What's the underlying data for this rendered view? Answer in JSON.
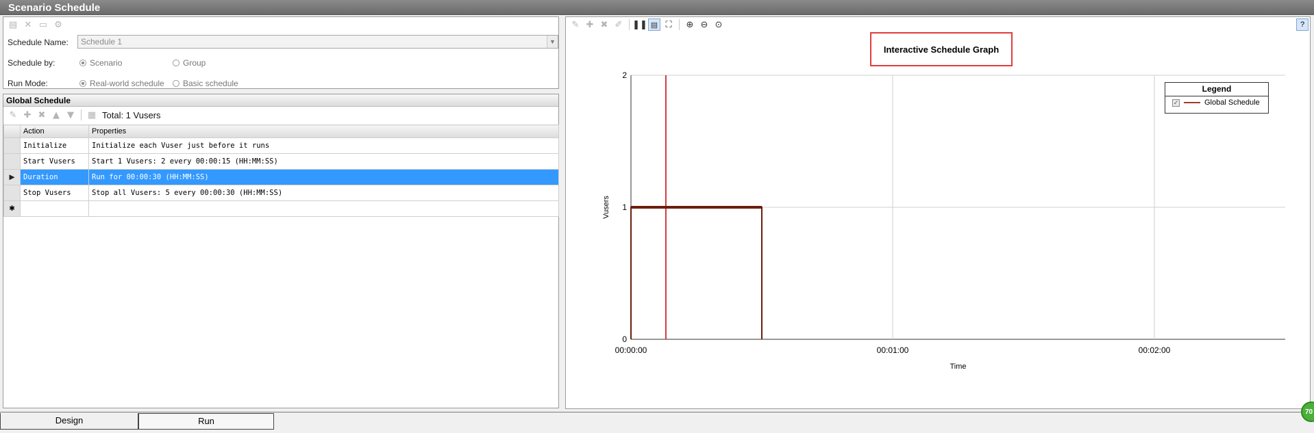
{
  "window": {
    "title": "Scenario Schedule"
  },
  "settings": {
    "schedule_name_label": "Schedule Name:",
    "schedule_name_value": "Schedule 1",
    "schedule_by_label": "Schedule by:",
    "schedule_by_options": [
      "Scenario",
      "Group"
    ],
    "schedule_by_selected": "Scenario",
    "run_mode_label": "Run Mode:",
    "run_mode_options": [
      "Real-world schedule",
      "Basic schedule"
    ],
    "run_mode_selected": "Real-world schedule"
  },
  "global_schedule": {
    "title": "Global Schedule",
    "total_label": "Total: 1 Vusers",
    "columns": [
      "Action",
      "Properties"
    ],
    "rows": [
      {
        "action": "Initialize",
        "properties": "Initialize each Vuser just before it runs"
      },
      {
        "action": "Start  Vusers",
        "properties": "Start 1 Vusers: 2 every 00:00:15 (HH:MM:SS)"
      },
      {
        "action": "Duration",
        "properties": "Run for 00:00:30 (HH:MM:SS)"
      },
      {
        "action": "Stop Vusers",
        "properties": "Stop all Vusers: 5 every 00:00:30 (HH:MM:SS)"
      }
    ],
    "selected_row": 2,
    "new_row_marker": "✱",
    "current_row_marker": "▶"
  },
  "tabs": {
    "design": "Design",
    "run": "Run"
  },
  "badge": {
    "text": "70"
  },
  "colors": {
    "accent": "#3399ff",
    "series": "#6b1e0e",
    "marker": "#d33a3a",
    "highlight_box": "#e03c3c"
  },
  "chart_data": {
    "type": "line",
    "title": "Interactive Schedule Graph",
    "xlabel": "Time",
    "ylabel": "Vusers",
    "x_ticks": [
      "00:00:00",
      "00:01:00",
      "00:02:00"
    ],
    "y_ticks": [
      "0",
      "1",
      "2"
    ],
    "xlim_seconds": [
      0,
      150
    ],
    "ylim": [
      0,
      2
    ],
    "grid": true,
    "legend": {
      "title": "Legend",
      "placement": "top-right"
    },
    "series": [
      {
        "name": "Global Schedule",
        "x_seconds": [
          0,
          0,
          30,
          30
        ],
        "y": [
          0,
          1,
          1,
          0
        ]
      }
    ],
    "marker_line_seconds": 8
  }
}
